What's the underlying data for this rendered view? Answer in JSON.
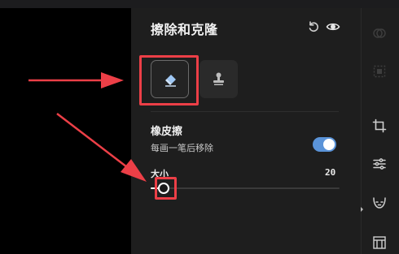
{
  "panel": {
    "title": "擦除和克隆",
    "header_icons": [
      "undo-icon",
      "eye-icon"
    ]
  },
  "tools": [
    {
      "name": "eraser",
      "icon": "eraser-icon",
      "selected": true
    },
    {
      "name": "clone-stamp",
      "icon": "stamp-icon",
      "selected": false
    }
  ],
  "mode": {
    "title": "橡皮擦",
    "description": "每画一笔后移除",
    "toggle_on": true
  },
  "size": {
    "label": "大小",
    "value": "20",
    "slider_fraction": 0.07
  },
  "rail": {
    "icons": [
      "overlap-circles-icon",
      "dashed-square-icon",
      "crop-icon",
      "sliders-icon",
      "face-icon",
      "frame-icon"
    ]
  },
  "colors": {
    "accent": "#5a93d8",
    "eraser_icon": "#9fc8f5",
    "highlight": "#ec3f47",
    "panel_bg": "#1e1e1e"
  }
}
